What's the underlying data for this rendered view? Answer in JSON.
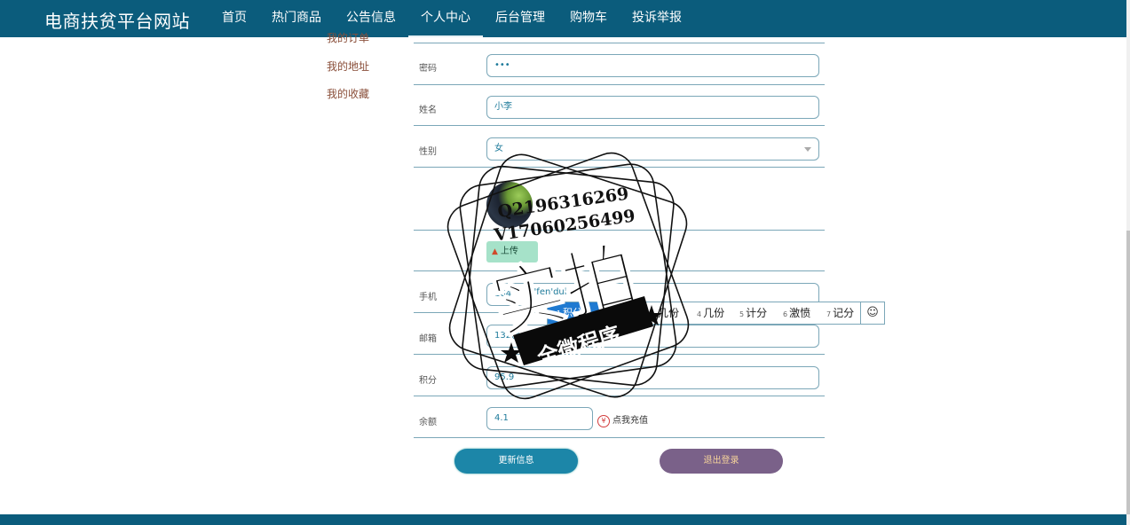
{
  "header": {
    "brand": "电商扶贫平台网站",
    "nav": [
      "首页",
      "热门商品",
      "公告信息",
      "个人中心",
      "后台管理",
      "购物车",
      "投诉举报"
    ],
    "active": "个人中心"
  },
  "sidebar": {
    "items": [
      "我的订单",
      "我的地址",
      "我的收藏"
    ]
  },
  "form": {
    "password": {
      "label": "密码",
      "value": "•••"
    },
    "name": {
      "label": "姓名",
      "value": "小李"
    },
    "gender": {
      "label": "性别",
      "value": "女"
    },
    "upload_label": "上传",
    "phone": {
      "label": "手机",
      "value": "164"
    },
    "email": {
      "label": "邮箱",
      "value": "132@"
    },
    "points": {
      "label": "积分",
      "value": "95.9"
    },
    "balance": {
      "label": "余额",
      "value": "4.1"
    },
    "recharge_label": "点我充值",
    "update_button": "更新信息",
    "logout_button": "退出登录"
  },
  "ime": {
    "typed": "ji'fen'dui",
    "candidates": [
      {
        "index": "1",
        "text": "积分兑"
      },
      {
        "index": "4",
        "text": "几份"
      },
      {
        "index": "5",
        "text": "计分"
      },
      {
        "index": "6",
        "text": "激愤"
      },
      {
        "index": "7",
        "text": "记分"
      }
    ],
    "hidden_candidate": "几份",
    "emoji": "☺"
  },
  "watermark": {
    "line1": "Q2196316269",
    "line2": "V17060256499",
    "big": "实拍",
    "ribbon": "全微程序"
  },
  "icons": {
    "upload": "upload-icon",
    "recharge": "yen-icon",
    "select": "chevron-down-icon",
    "emoji": "smile-icon"
  },
  "colors": {
    "header_bg": "#0b5c7c",
    "rule": "#7ba7b8",
    "sidebar_link": "#8a4f3a",
    "update_btn": "#1c86a8",
    "logout_btn": "#7a6189"
  }
}
